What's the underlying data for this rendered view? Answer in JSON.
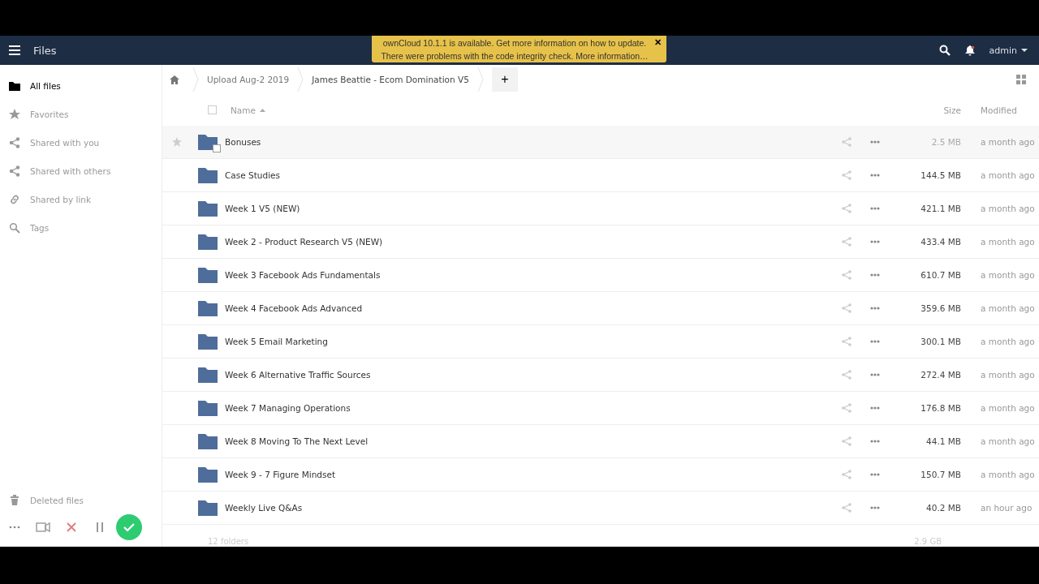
{
  "header": {
    "app_title": "Files",
    "user": "admin"
  },
  "notification": {
    "lines": [
      "ownCloud 10.1.1 is available. Get more information on how to update.",
      "There were problems with the code integrity check. More information…"
    ],
    "close": "✕"
  },
  "sidebar": {
    "items": [
      {
        "kind": "folder",
        "label": "All files",
        "selected": true
      },
      {
        "kind": "star",
        "label": "Favorites",
        "selected": false
      },
      {
        "kind": "share",
        "label": "Shared with you",
        "selected": false
      },
      {
        "kind": "share",
        "label": "Shared with others",
        "selected": false
      },
      {
        "kind": "link",
        "label": "Shared by link",
        "selected": false
      },
      {
        "kind": "tag",
        "label": "Tags",
        "selected": false
      }
    ],
    "bottom_items": [
      {
        "kind": "trash",
        "label": "Deleted files",
        "selected": false
      }
    ]
  },
  "breadcrumbs": [
    "Upload Aug-2 2019",
    "James Beattie - Ecom Domination V5"
  ],
  "new_button": "+",
  "table": {
    "select_all": {
      "checked": false
    },
    "columns": [
      "Name",
      "Size",
      "Modified"
    ],
    "rows": [
      {
        "name": "Bonuses",
        "size": "2.5 MB",
        "modified": "a month ago",
        "highlighted": true
      },
      {
        "name": "Case Studies",
        "size": "144.5 MB",
        "modified": "a month ago",
        "highlighted": false
      },
      {
        "name": "Week 1 V5 (NEW)",
        "size": "421.1 MB",
        "modified": "a month ago",
        "highlighted": false
      },
      {
        "name": "Week 2 - Product Research V5 (NEW)",
        "size": "433.4 MB",
        "modified": "a month ago",
        "highlighted": false
      },
      {
        "name": "Week 3 Facebook Ads Fundamentals",
        "size": "610.7 MB",
        "modified": "a month ago",
        "highlighted": false
      },
      {
        "name": "Week 4 Facebook Ads Advanced",
        "size": "359.6 MB",
        "modified": "a month ago",
        "highlighted": false
      },
      {
        "name": "Week 5 Email Marketing",
        "size": "300.1 MB",
        "modified": "a month ago",
        "highlighted": false
      },
      {
        "name": "Week 6 Alternative Traffic Sources",
        "size": "272.4 MB",
        "modified": "a month ago",
        "highlighted": false
      },
      {
        "name": "Week 7 Managing Operations",
        "size": "176.8 MB",
        "modified": "a month ago",
        "highlighted": false
      },
      {
        "name": "Week 8 Moving To The Next Level",
        "size": "44.1 MB",
        "modified": "a month ago",
        "highlighted": false
      },
      {
        "name": "Week 9 - 7 Figure Mindset",
        "size": "150.7 MB",
        "modified": "a month ago",
        "highlighted": false
      },
      {
        "name": "Weekly Live Q&As",
        "size": "40.2 MB",
        "modified": "an hour ago",
        "highlighted": false
      }
    ],
    "footer": {
      "count": "12 folders",
      "total": "2.9 GB"
    }
  }
}
